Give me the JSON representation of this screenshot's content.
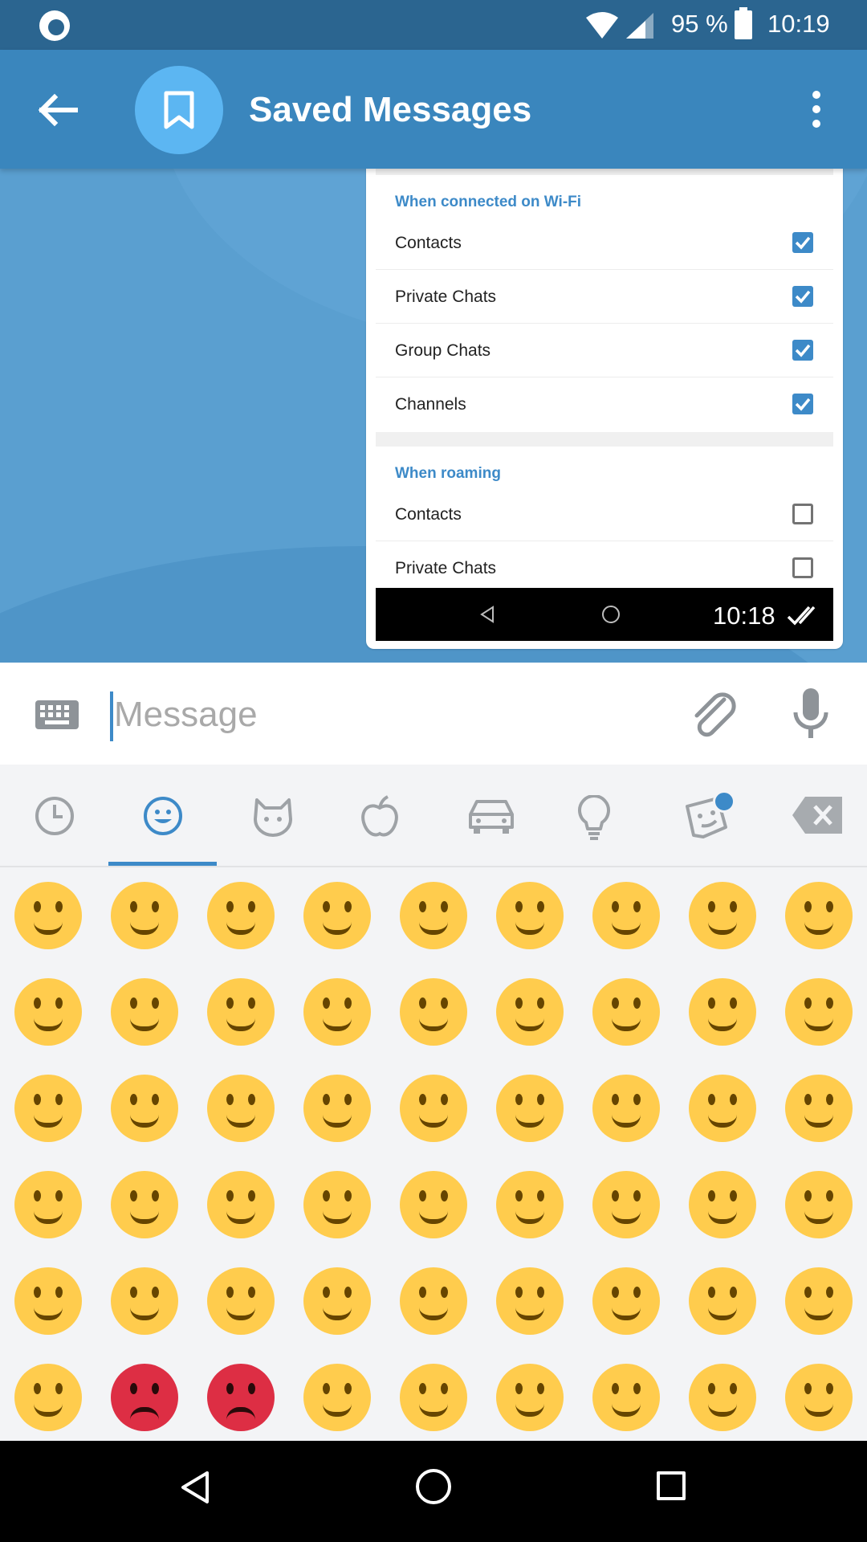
{
  "status_bar": {
    "battery": "95 %",
    "time": "10:19",
    "icons": [
      "firefox-icon",
      "wifi-icon",
      "signal-icon",
      "battery-icon"
    ]
  },
  "header": {
    "title": "Saved Messages",
    "icons": [
      "back-arrow-icon",
      "bookmark-icon",
      "more-vert-icon"
    ]
  },
  "message": {
    "time": "10:18",
    "status_icon": "double-check-icon",
    "screenshot": {
      "wifi_section": {
        "title": "When connected on Wi-Fi",
        "items": [
          {
            "label": "Contacts",
            "checked": true
          },
          {
            "label": "Private Chats",
            "checked": true
          },
          {
            "label": "Group Chats",
            "checked": true
          },
          {
            "label": "Channels",
            "checked": true
          }
        ]
      },
      "roaming_section": {
        "title": "When roaming",
        "items": [
          {
            "label": "Contacts",
            "checked": false
          },
          {
            "label": "Private Chats",
            "checked": false
          }
        ]
      }
    }
  },
  "input": {
    "placeholder": "Message",
    "value": "",
    "icons": [
      "keyboard-icon",
      "attach-icon",
      "mic-icon"
    ]
  },
  "emoji_panel": {
    "tabs": [
      "recent-icon",
      "smiley-icon",
      "cat-icon",
      "apple-icon",
      "car-icon",
      "lightbulb-icon",
      "sticker-icon",
      "backspace-icon"
    ],
    "selected_tab": 1,
    "emoji_rows": [
      [
        "😀",
        "😃",
        "😄",
        "😁",
        "😆",
        "😅",
        "😂",
        "🤣",
        "☺️"
      ],
      [
        "😊",
        "😇",
        "🙂",
        "🙃",
        "😉",
        "😌",
        "😍",
        "😘",
        "😗"
      ],
      [
        "😙",
        "😚",
        "😋",
        "😛",
        "😝",
        "😜",
        "🤪",
        "🤨",
        "🧐"
      ],
      [
        "🤓",
        "😎",
        "🤩",
        "😏",
        "😒",
        "😞",
        "😔",
        "😟",
        "😕"
      ],
      [
        "🙁",
        "☹️",
        "😣",
        "😖",
        "😫",
        "😩",
        "😢",
        "😭",
        "😤"
      ],
      [
        "😠",
        "😡",
        "🤬",
        "🤯",
        "😳",
        "😱",
        "😨",
        "😰",
        "😥"
      ]
    ]
  },
  "colors": {
    "status_bar": "#2b6590",
    "action_bar": "#3a86bd",
    "chat_background": "#5a9fd0",
    "accent": "#3d8ac8",
    "emoji_yellow": "#ffcc4d"
  }
}
